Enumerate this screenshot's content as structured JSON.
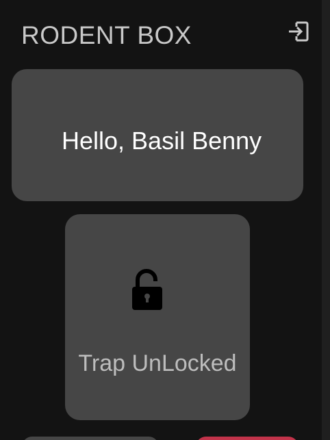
{
  "header": {
    "title": "RODENT BOX",
    "logout_icon": "logout-icon"
  },
  "greeting": {
    "text": "Hello, Basil Benny"
  },
  "trap": {
    "status_label": "Trap UnLocked",
    "icon": "lock-open-icon"
  },
  "colors": {
    "background": "#131313",
    "card": "#464646",
    "title_text": "#c9c9c9",
    "accent_red": "#c2334a"
  }
}
